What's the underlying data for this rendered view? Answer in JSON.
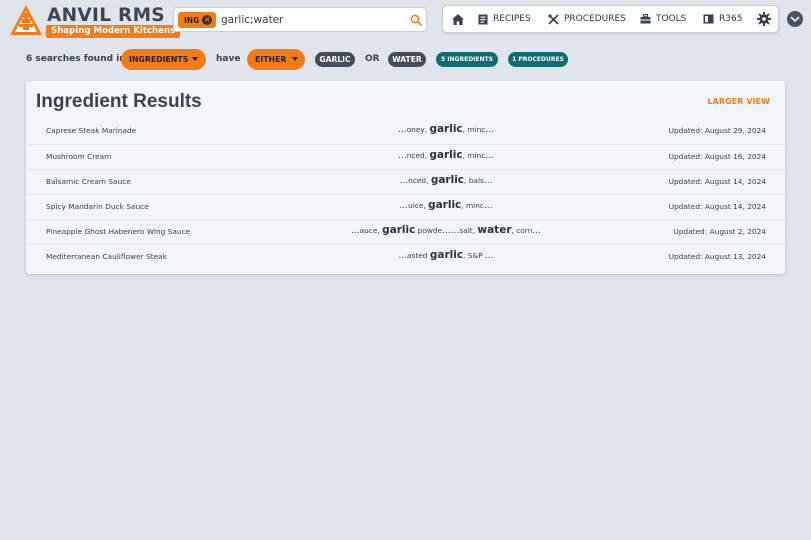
{
  "app": {
    "name": "ANVIL RMS",
    "tagline": "Shaping Modern Kitchens",
    "colors": {
      "accent": "#f57c14",
      "dark": "#454c5a",
      "teal": "#0e6c73",
      "background": "#dfe4ed"
    }
  },
  "search": {
    "chip_label": "ING",
    "chip_remove_icon": "close-circle-icon",
    "value": "garlic;water",
    "placeholder": "",
    "icon": "search-icon"
  },
  "nav": {
    "items": [
      {
        "id": "home",
        "label": "",
        "icon": "home-icon"
      },
      {
        "id": "recipes",
        "label": "RECIPES",
        "icon": "recipe-book-icon"
      },
      {
        "id": "procedures",
        "label": "PROCEDURES",
        "icon": "utensils-icon"
      },
      {
        "id": "tools",
        "label": "TOOLS",
        "icon": "toolbox-icon"
      },
      {
        "id": "r365",
        "label": "R365",
        "icon": "r365-icon"
      },
      {
        "id": "settings",
        "label": "",
        "icon": "gear-icon"
      }
    ],
    "menu_icon": "chevron-down-icon"
  },
  "filters": {
    "summary": "6 searches found in",
    "scope": "INGREDIENTS",
    "have_label": "have",
    "mode": "EITHER",
    "terms": [
      "GARLIC",
      "WATER"
    ],
    "or_label": "OR",
    "counts": {
      "ingredients": "5 INGREDIENTS",
      "procedures": "1 PROCEDURES"
    }
  },
  "results": {
    "title": "Ingredient Results",
    "larger_view_label": "LARGER VIEW",
    "rows": [
      {
        "name": "Caprese Steak Marinade",
        "updated": "Updated: August 29, 2024",
        "snippet": [
          {
            "t": "...",
            "s": "dots"
          },
          {
            "t": "oney, "
          },
          {
            "t": "garlic",
            "s": "hit"
          },
          {
            "t": ", minc"
          },
          {
            "t": "...",
            "s": "dots"
          }
        ]
      },
      {
        "name": "Mushroom Cream",
        "updated": "Updated: August 16, 2024",
        "snippet": [
          {
            "t": "...",
            "s": "dots"
          },
          {
            "t": "nced, "
          },
          {
            "t": "garlic",
            "s": "hit"
          },
          {
            "t": ", minc"
          },
          {
            "t": "...",
            "s": "dots"
          }
        ]
      },
      {
        "name": "Balsamic Cream Sauce",
        "updated": "Updated: August 14, 2024",
        "snippet": [
          {
            "t": "...",
            "s": "dots"
          },
          {
            "t": "nced, "
          },
          {
            "t": "garlic",
            "s": "hit"
          },
          {
            "t": ", bals"
          },
          {
            "t": "...",
            "s": "dots"
          }
        ]
      },
      {
        "name": "Spicy Mandarin Duck Sauce",
        "updated": "Updated: August 14, 2024",
        "snippet": [
          {
            "t": "...",
            "s": "dots"
          },
          {
            "t": "uice, "
          },
          {
            "t": "garlic",
            "s": "hit"
          },
          {
            "t": ", minc"
          },
          {
            "t": "...",
            "s": "dots"
          }
        ]
      },
      {
        "name": "Pineapple Ghost Habenero Wing Sauce",
        "updated": "Updated: August 2, 2024",
        "snippet": [
          {
            "t": "...",
            "s": "dots"
          },
          {
            "t": "auce, "
          },
          {
            "t": "garlic",
            "s": "hit"
          },
          {
            "t": " powde"
          },
          {
            "t": "......",
            "s": "dots"
          },
          {
            "t": "salt, "
          },
          {
            "t": "water",
            "s": "hit"
          },
          {
            "t": ", corn"
          },
          {
            "t": "...",
            "s": "dots"
          }
        ]
      },
      {
        "name": "Mediterranean Cauliflower Steak",
        "updated": "Updated: August 13, 2024",
        "snippet": [
          {
            "t": "...",
            "s": "dots"
          },
          {
            "t": "asted "
          },
          {
            "t": "garlic",
            "s": "hit"
          },
          {
            "t": ", S&P "
          },
          {
            "t": "...",
            "s": "dots"
          }
        ]
      }
    ]
  }
}
